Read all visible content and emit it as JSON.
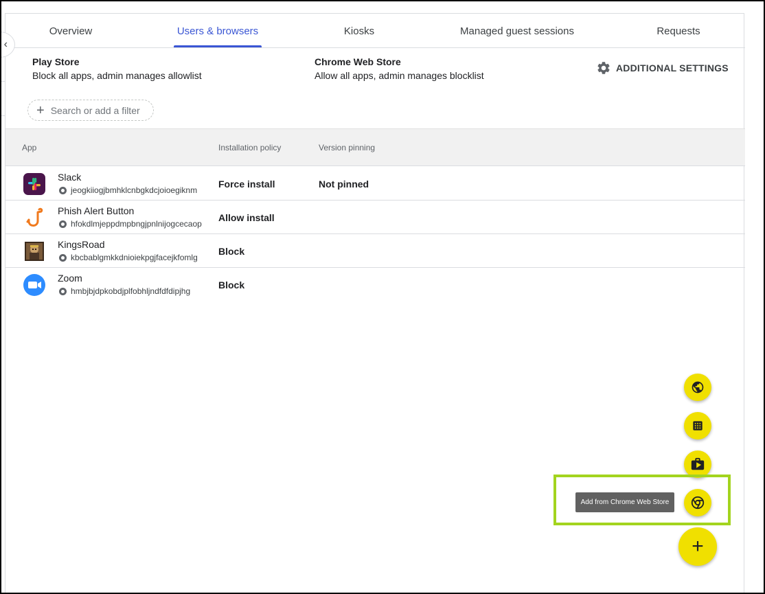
{
  "tabs": [
    {
      "label": "Overview",
      "active": false
    },
    {
      "label": "Users & browsers",
      "active": true
    },
    {
      "label": "Kiosks",
      "active": false
    },
    {
      "label": "Managed guest sessions",
      "active": false
    },
    {
      "label": "Requests",
      "active": false
    }
  ],
  "policies": {
    "play_store": {
      "title": "Play Store",
      "value": "Block all apps, admin manages allowlist"
    },
    "chrome_web_store": {
      "title": "Chrome Web Store",
      "value": "Allow all apps, admin manages blocklist"
    }
  },
  "additional_settings": {
    "label": "ADDITIONAL SETTINGS",
    "icon": "gear-icon"
  },
  "filter": {
    "placeholder": "Search or add a filter"
  },
  "table": {
    "headers": {
      "app": "App",
      "policy": "Installation policy",
      "pinning": "Version pinning"
    },
    "rows": [
      {
        "name": "Slack",
        "id": "jeogkiiogjbmhklcnbgkdcjoioegiknm",
        "policy": "Force install",
        "pinning": "Not pinned",
        "icon": "slack-icon"
      },
      {
        "name": "Phish Alert Button",
        "id": "hfokdlmjeppdmpbngjpnlnijogcecaop",
        "policy": "Allow install",
        "pinning": "",
        "icon": "fishhook-icon"
      },
      {
        "name": "KingsRoad",
        "id": "kbcbablgmkkdnioiekpgjfacejkfomlg",
        "policy": "Block",
        "pinning": "",
        "icon": "kingsroad-icon"
      },
      {
        "name": "Zoom",
        "id": "hmbjbjdpkobdjplfobhljndfdfdipjhg",
        "policy": "Block",
        "pinning": "",
        "icon": "zoom-icon"
      }
    ]
  },
  "fab_menu": {
    "items": [
      {
        "icon": "globe-icon"
      },
      {
        "icon": "grid-icon"
      },
      {
        "icon": "play-store-icon"
      },
      {
        "icon": "chrome-icon",
        "tooltip": "Add from Chrome Web Store"
      }
    ],
    "main_icon": "plus-icon",
    "main_label": "+"
  },
  "colors": {
    "accent": "#3a56d4",
    "fab": "#f0e000",
    "highlight": "#a3d41e"
  }
}
